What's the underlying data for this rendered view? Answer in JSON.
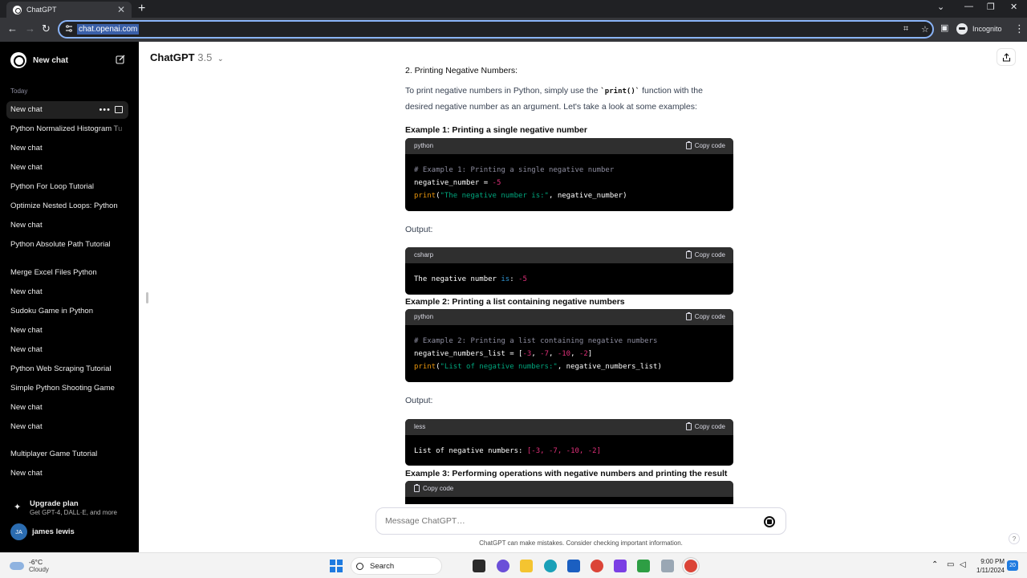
{
  "browser": {
    "tab_title": "ChatGPT",
    "tab_close": "✕",
    "new_tab": "+",
    "url": "chat.openai.com",
    "profile_label": "Incognito"
  },
  "sidebar": {
    "new_chat_label": "New chat",
    "section_label": "Today",
    "items": [
      {
        "label": "New chat"
      },
      {
        "label": "Python Normalized Histogram Tu"
      },
      {
        "label": "New chat"
      },
      {
        "label": "New chat"
      },
      {
        "label": "Python For Loop Tutorial"
      },
      {
        "label": "Optimize Nested Loops: Python"
      },
      {
        "label": "New chat"
      },
      {
        "label": "Python Absolute Path Tutorial"
      },
      {
        "label": "Merge Excel Files Python"
      },
      {
        "label": "New chat"
      },
      {
        "label": "Sudoku Game in Python"
      },
      {
        "label": "New chat"
      },
      {
        "label": "New chat"
      },
      {
        "label": "Python Web Scraping Tutorial"
      },
      {
        "label": "Simple Python Shooting Game"
      },
      {
        "label": "New chat"
      },
      {
        "label": "New chat"
      },
      {
        "label": "Multiplayer Game Tutorial"
      },
      {
        "label": "New chat"
      }
    ],
    "upgrade": {
      "title": "Upgrade plan",
      "subtitle": "Get GPT-4, DALL·E, and more"
    },
    "user": {
      "initials": "JA",
      "name": "james lewis"
    }
  },
  "header": {
    "model_name": "ChatGPT",
    "model_version": "3.5",
    "chevron": "⌄"
  },
  "content": {
    "cut_heading": "2. Printing Negative Numbers:",
    "intro_before": "To print negative numbers in Python, simply use the ",
    "intro_code": "`print()`",
    "intro_after": " function with the desired negative number as an argument. Let's take a look at some examples:",
    "example1_heading": "Example 1: Printing a single negative number",
    "example2_heading": "Example 2: Printing a list containing negative numbers",
    "example3_heading": "Example 3: Performing operations with negative numbers and printing the result",
    "output_label": "Output:",
    "copy_label": "Copy code",
    "blocks": {
      "b1": {
        "lang": "python",
        "line1": "# Example 1: Printing a single negative number",
        "line2_a": "negative_number = ",
        "line2_num": "-5",
        "line3_fn": "print",
        "line3_str": "\"The negative number is:\"",
        "line3_rest": ", negative_number)"
      },
      "b2": {
        "lang": "csharp",
        "text_a": "The negative number ",
        "kw": "is",
        "text_b": ": ",
        "num": "-5"
      },
      "b3": {
        "lang": "python",
        "line1": "# Example 2: Printing a list containing negative numbers",
        "line2_a": "negative_numbers_list = [",
        "n1": "-3",
        "n2": "-7",
        "n3": "-10",
        "n4": "-2",
        "line3_fn": "print",
        "line3_str": "\"List of negative numbers:\"",
        "line3_rest": ", negative_numbers_list)"
      },
      "b4": {
        "lang": "less",
        "text_a": "List of negative numbers: ",
        "list": "[-3, -7, -10, -2]"
      }
    }
  },
  "composer": {
    "placeholder": "Message ChatGPT…",
    "disclaimer": "ChatGPT can make mistakes. Consider checking important information.",
    "help": "?"
  },
  "taskbar": {
    "temperature": "-6°C",
    "weather": "Cloudy",
    "search_label": "Search",
    "time": "9:00 PM",
    "date": "1/11/2024",
    "notifications": "20"
  }
}
